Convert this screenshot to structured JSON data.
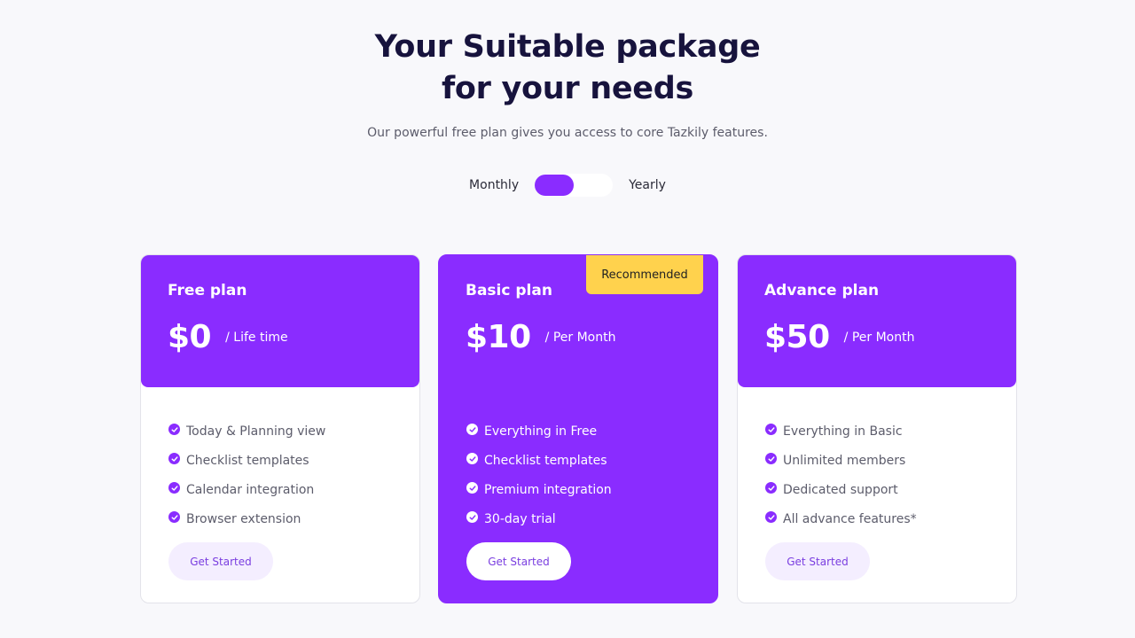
{
  "header": {
    "title_line1": "Your Suitable package",
    "title_line2": "for your needs",
    "subtitle": "Our powerful free plan gives you access to core Tazkily features."
  },
  "billing_toggle": {
    "left_label": "Monthly",
    "right_label": "Yearly",
    "selected": "Monthly"
  },
  "colors": {
    "accent": "#8a2cff",
    "badge": "#ffd24d",
    "title": "#17133d"
  },
  "plans": [
    {
      "name": "Free plan",
      "price": "$0",
      "period": "/ Life time",
      "features": [
        "Today & Planning view",
        "Checklist templates",
        "Calendar integration",
        "Browser extension"
      ],
      "button": "Get Started",
      "check_icon": "check-circle-icon"
    },
    {
      "name": "Basic plan",
      "price": "$10",
      "period": "/ Per Month",
      "badge": "Recommended",
      "features": [
        "Everything in Free",
        "Checklist templates",
        "Premium integration",
        "30-day trial"
      ],
      "button": "Get Started",
      "check_icon": "check-circle-icon"
    },
    {
      "name": "Advance plan",
      "price": "$50",
      "period": "/ Per Month",
      "features": [
        "Everything in Basic",
        "Unlimited members",
        "Dedicated support",
        "All advance features*"
      ],
      "button": "Get Started",
      "check_icon": "check-circle-icon"
    }
  ]
}
